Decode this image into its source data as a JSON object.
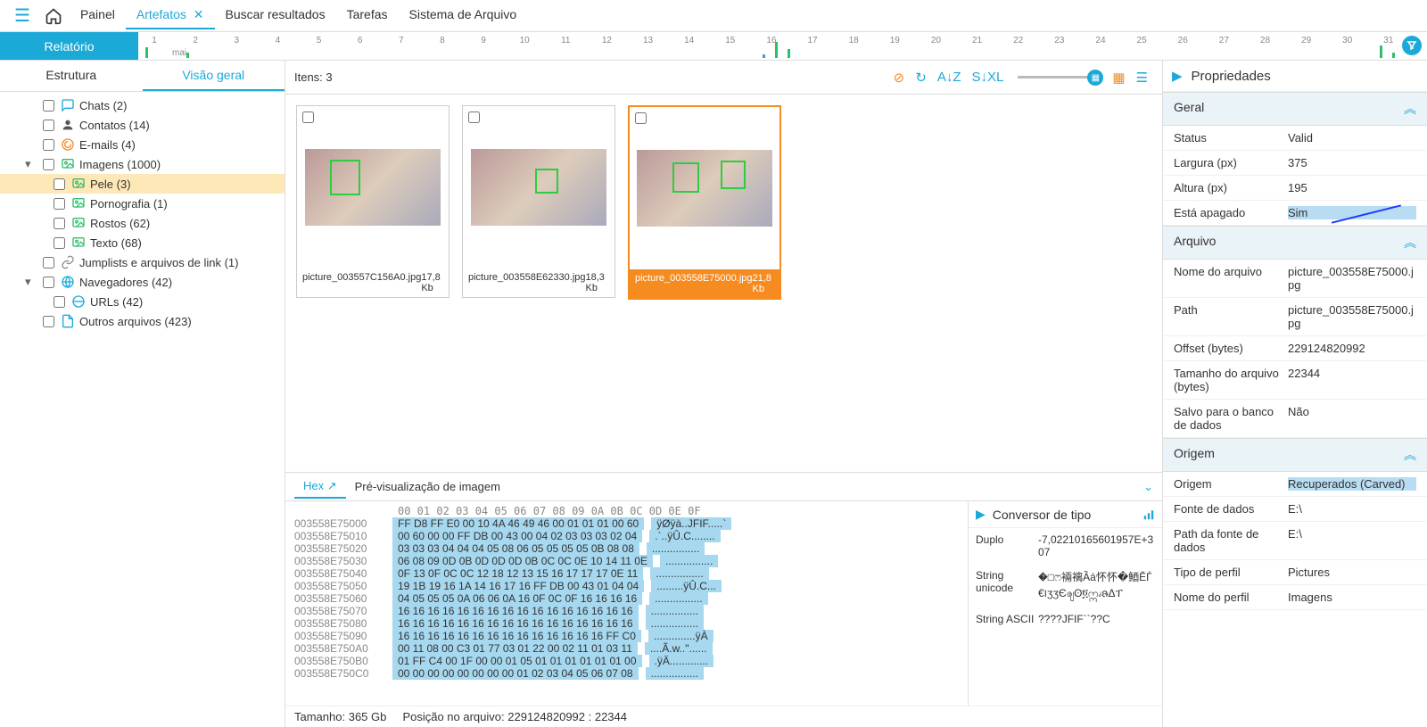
{
  "topbar": {
    "tabs": [
      "Painel",
      "Artefatos",
      "Buscar resultados",
      "Tarefas",
      "Sistema de Arquivo"
    ],
    "active_index": 1
  },
  "report_button": "Relatório",
  "timeline": {
    "month_label": "mai",
    "ticks": [
      "1",
      "2",
      "3",
      "4",
      "5",
      "6",
      "7",
      "8",
      "9",
      "10",
      "11",
      "12",
      "13",
      "14",
      "15",
      "16",
      "17",
      "18",
      "19",
      "20",
      "21",
      "22",
      "23",
      "24",
      "25",
      "26",
      "27",
      "28",
      "29",
      "30",
      "31"
    ]
  },
  "left_tabs": {
    "items": [
      "Estrutura",
      "Visão geral"
    ],
    "active_index": 1
  },
  "tree": [
    {
      "label": "Chats (2)",
      "icon": "chat",
      "indent": 1
    },
    {
      "label": "Contatos (14)",
      "icon": "contact",
      "indent": 1
    },
    {
      "label": "E-mails (4)",
      "icon": "email",
      "indent": 1
    },
    {
      "label": "Imagens (1000)",
      "icon": "image",
      "indent": 1,
      "caret": "down"
    },
    {
      "label": "Pele (3)",
      "icon": "image",
      "indent": 2,
      "selected": true
    },
    {
      "label": "Pornografia (1)",
      "icon": "image",
      "indent": 2
    },
    {
      "label": "Rostos (62)",
      "icon": "image",
      "indent": 2
    },
    {
      "label": "Texto (68)",
      "icon": "image",
      "indent": 2
    },
    {
      "label": "Jumplists e arquivos de link (1)",
      "icon": "link",
      "indent": 1
    },
    {
      "label": "Navegadores (42)",
      "icon": "globe",
      "indent": 1,
      "caret": "down"
    },
    {
      "label": "URLs (42)",
      "icon": "globe2",
      "indent": 2
    },
    {
      "label": "Outros arquivos (423)",
      "icon": "file",
      "indent": 1
    }
  ],
  "center": {
    "items_label": "Itens: 3",
    "thumbs": [
      {
        "filename": "picture_003557C156A0.jpg",
        "size": "17,8 Kb",
        "selected": false
      },
      {
        "filename": "picture_003558E62330.jpg",
        "size": "18,3 Kb",
        "selected": false
      },
      {
        "filename": "picture_003558E75000.jpg",
        "size": "21,8 Kb",
        "selected": true
      }
    ]
  },
  "hex": {
    "tabs": [
      "Hex",
      "Pré-visualização de imagem"
    ],
    "active_index": 0,
    "header": "00 01 02 03 04 05 06 07 08 09 0A 0B 0C 0D 0E 0F",
    "lines": [
      {
        "addr": "003558E75000",
        "bytes": "FF D8 FF E0 00 10 4A 46 49 46 00 01 01 01 00 60",
        "ascii": "ÿØÿà..JFIF.....`"
      },
      {
        "addr": "003558E75010",
        "bytes": "00 60 00 00 FF DB 00 43 00 04 02 03 03 03 02 04",
        "ascii": ".`..ÿÛ.C........"
      },
      {
        "addr": "003558E75020",
        "bytes": "03 03 03 04 04 04 05 08 06 05 05 05 05 0B 08 08",
        "ascii": "................"
      },
      {
        "addr": "003558E75030",
        "bytes": "06 08 09 0D 0B 0D 0D 0D 0B 0C 0C 0E 10 14 11 0E",
        "ascii": "................"
      },
      {
        "addr": "003558E75040",
        "bytes": "0F 13 0F 0C 0C 12 18 12 13 15 16 17 17 17 0E 11",
        "ascii": "................"
      },
      {
        "addr": "003558E75050",
        "bytes": "19 1B 19 16 1A 14 16 17 16 FF DB 00 43 01 04 04",
        "ascii": ".........ÿÛ.C..."
      },
      {
        "addr": "003558E75060",
        "bytes": "04 05 05 05 0A 06 06 0A 16 0F 0C 0F 16 16 16 16",
        "ascii": "................"
      },
      {
        "addr": "003558E75070",
        "bytes": "16 16 16 16 16 16 16 16 16 16 16 16 16 16 16 16",
        "ascii": "................"
      },
      {
        "addr": "003558E75080",
        "bytes": "16 16 16 16 16 16 16 16 16 16 16 16 16 16 16 16",
        "ascii": "................"
      },
      {
        "addr": "003558E75090",
        "bytes": "16 16 16 16 16 16 16 16 16 16 16 16 16 16 FF C0",
        "ascii": "..............ÿÀ"
      },
      {
        "addr": "003558E750A0",
        "bytes": "00 11 08 00 C3 01 77 03 01 22 00 02 11 01 03 11",
        "ascii": "....Ã.w..\"......"
      },
      {
        "addr": "003558E750B0",
        "bytes": "01 FF C4 00 1F 00 00 01 05 01 01 01 01 01 01 00",
        "ascii": ".ÿÄ............."
      },
      {
        "addr": "003558E750C0",
        "bytes": "00 00 00 00 00 00 00 00 01 02 03 04 05 06 07 08",
        "ascii": "................"
      }
    ],
    "status_prefix": "Tamanho:",
    "status_size": "365 Gb",
    "status_pos_prefix": "Posição no arquivo:",
    "status_pos": "229124820992 : 22344"
  },
  "typeconv": {
    "title": "Conversor de tipo",
    "rows": [
      {
        "label": "Duplo",
        "value": "-7,02210165601957E+307"
      },
      {
        "label": "String unicode",
        "value": "�□ෆ裲褵Ȁá怀怀�鯂ĔЃ€౹ʒʒЄၛʘ፬ဣၧຨΔፐ"
      },
      {
        "label": "String ASCII",
        "value": "????JFIF``??C"
      }
    ]
  },
  "properties": {
    "title": "Propriedades",
    "sections": {
      "geral": {
        "title": "Geral",
        "rows": [
          {
            "label": "Status",
            "value": "Valid"
          },
          {
            "label": "Largura (px)",
            "value": "375"
          },
          {
            "label": "Altura (px)",
            "value": "195"
          },
          {
            "label": "Está apagado",
            "value": "Sim",
            "hl": true,
            "arrow": true
          }
        ]
      },
      "arquivo": {
        "title": "Arquivo",
        "rows": [
          {
            "label": "Nome do arquivo",
            "value": "picture_003558E75000.jpg"
          },
          {
            "label": "Path",
            "value": "picture_003558E75000.jpg"
          },
          {
            "label": "Offset (bytes)",
            "value": "229124820992"
          },
          {
            "label": "Tamanho do arquivo (bytes)",
            "value": "22344"
          },
          {
            "label": "Salvo para o banco de dados",
            "value": "Não"
          }
        ]
      },
      "origem": {
        "title": "Origem",
        "rows": [
          {
            "label": "Origem",
            "value": "Recuperados (Carved)",
            "hl": true
          },
          {
            "label": "Fonte de dados",
            "value": "E:\\"
          },
          {
            "label": "Path da fonte de dados",
            "value": "E:\\"
          },
          {
            "label": "Tipo de perfil",
            "value": "Pictures"
          },
          {
            "label": "Nome do perfil",
            "value": "Imagens"
          }
        ]
      }
    }
  }
}
